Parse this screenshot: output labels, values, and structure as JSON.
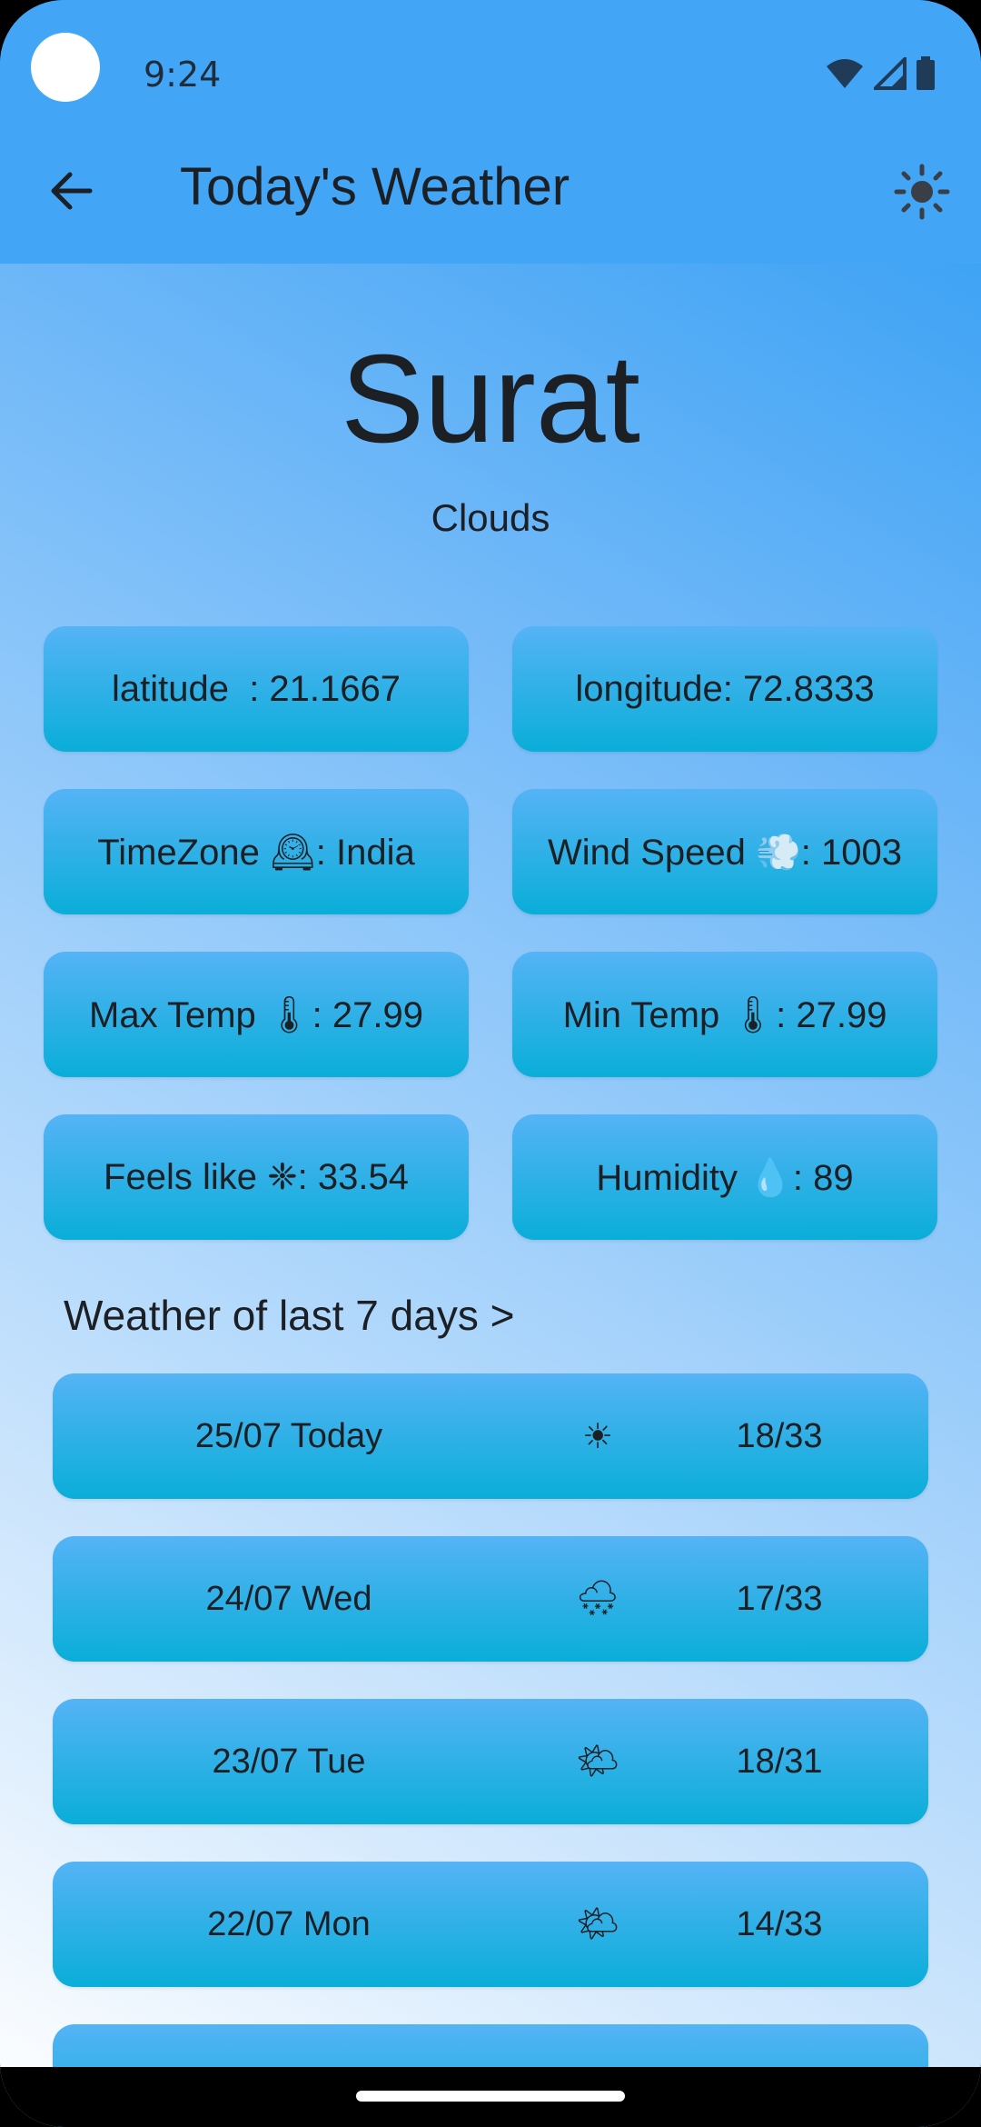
{
  "status_bar": {
    "time": "9:24",
    "icons": [
      "wifi-icon",
      "signal-icon",
      "battery-icon"
    ]
  },
  "app_bar": {
    "title": "Today's Weather",
    "back_icon": "arrow-back-icon",
    "theme_icon": "sun-icon"
  },
  "city": {
    "name": "Surat",
    "condition": "Clouds"
  },
  "stats": [
    {
      "label": "latitude  : 21.1667"
    },
    {
      "label": "longitude: 72.8333"
    },
    {
      "label": "TimeZone 🕰: India"
    },
    {
      "label": "Wind Speed 💨: 1003"
    },
    {
      "label": "Max Temp 🌡: 27.99"
    },
    {
      "label": "Min Temp 🌡: 27.99"
    },
    {
      "label": "Feels like ❈: 33.54"
    },
    {
      "label": "Humidity 💧: 89"
    }
  ],
  "history": {
    "title": "Weather of last 7 days >",
    "days": [
      {
        "date": "25/07 Today",
        "icon": "☀",
        "icon_name": "sun-icon",
        "temp": "18/33"
      },
      {
        "date": "24/07 Wed",
        "icon": "🌨",
        "icon_name": "snow-cloud-icon",
        "temp": "17/33"
      },
      {
        "date": "23/07 Tue",
        "icon": "🌤",
        "icon_name": "sun-behind-cloud-icon",
        "temp": "18/31"
      },
      {
        "date": "22/07 Mon",
        "icon": "🌤",
        "icon_name": "sun-behind-cloud-icon",
        "temp": "14/33"
      }
    ]
  },
  "colors": {
    "app_bar": "#42a5f5",
    "card_top": "#55b3f6",
    "card_bottom": "#0aaed8",
    "text": "#1c1f24"
  }
}
